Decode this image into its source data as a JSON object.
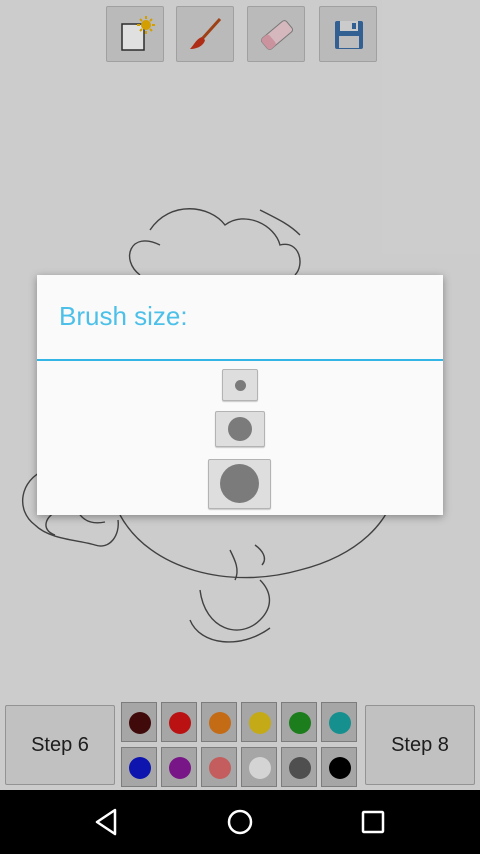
{
  "app": {
    "toolbar": [
      {
        "icon": "new-page-icon"
      },
      {
        "icon": "paint-brush-icon"
      },
      {
        "icon": "eraser-icon"
      },
      {
        "icon": "save-floppy-icon"
      }
    ],
    "step_prev_label": "Step 6",
    "step_next_label": "Step 8",
    "palette": {
      "row1": [
        "#4a0c0c",
        "#d41515",
        "#e07a1a",
        "#e0c21a",
        "#1f8f1f",
        "#1aa3a3"
      ],
      "row2": [
        "#1018c8",
        "#8a1a9a",
        "#e06a6a",
        "#f2f2f2",
        "#5a5a5a",
        "#000000"
      ]
    }
  },
  "dialog": {
    "title": "Brush size:",
    "accent": "#33b5e5",
    "sizes": [
      "small",
      "medium",
      "large"
    ]
  },
  "navbar": {
    "icons": [
      "back-icon",
      "home-icon",
      "recent-apps-icon"
    ]
  }
}
